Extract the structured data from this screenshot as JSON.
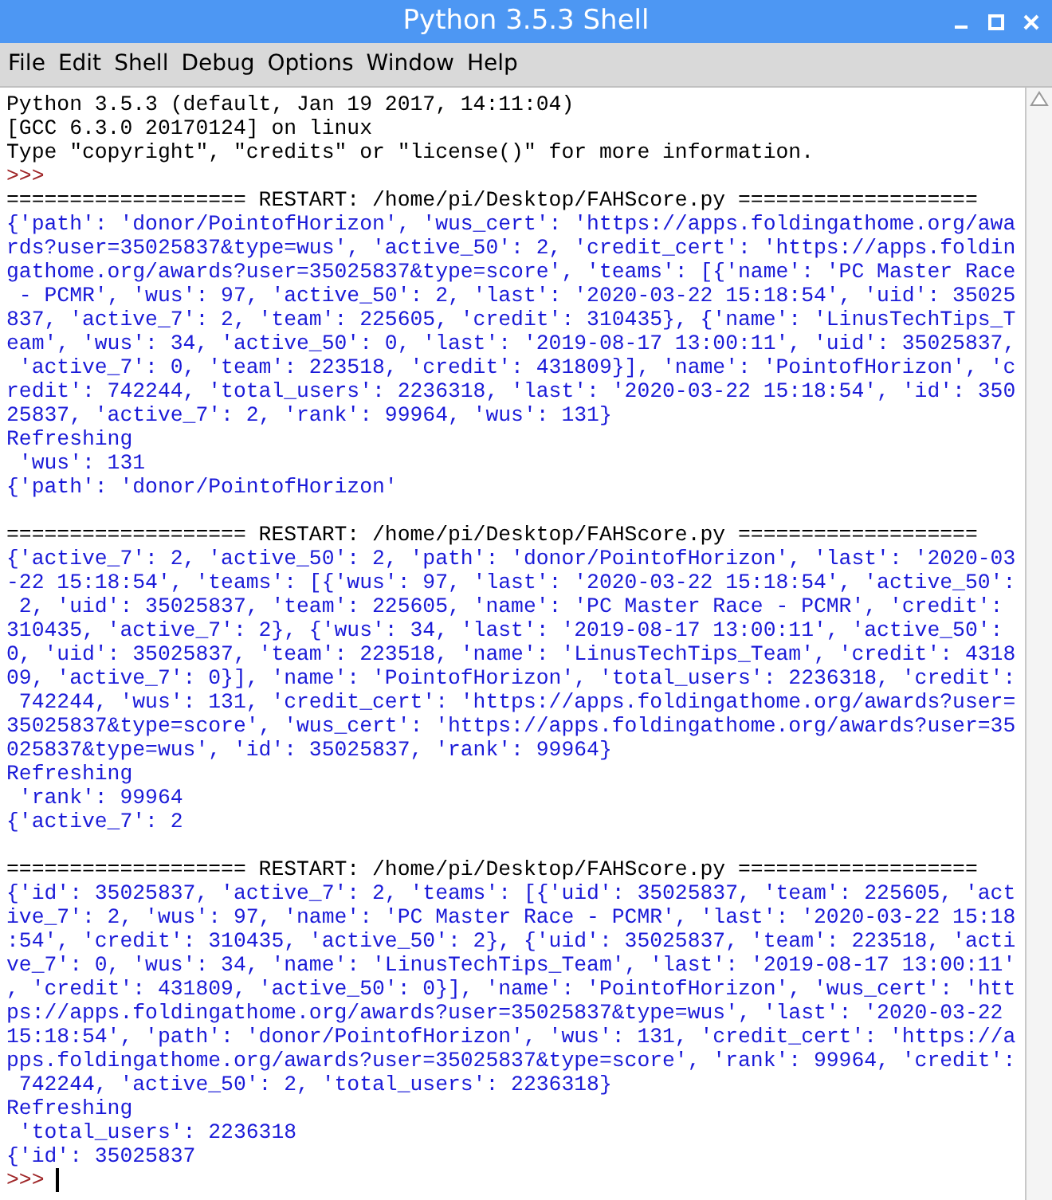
{
  "window": {
    "title": "Python 3.5.3 Shell"
  },
  "menu": [
    "File",
    "Edit",
    "Shell",
    "Debug",
    "Options",
    "Window",
    "Help"
  ],
  "lines": [
    {
      "kind": "banner",
      "text": "Python 3.5.3 (default, Jan 19 2017, 14:11:04)"
    },
    {
      "kind": "banner",
      "text": "[GCC 6.3.0 20170124] on linux"
    },
    {
      "kind": "banner",
      "text": "Type \"copyright\", \"credits\" or \"license()\" for more information."
    },
    {
      "kind": "prompt",
      "text": ">>>",
      "cursor": false
    },
    {
      "kind": "restart",
      "text": "=================== RESTART: /home/pi/Desktop/FAHScore.py ==================="
    },
    {
      "kind": "output",
      "text": "{'path': 'donor/PointofHorizon', 'wus_cert': 'https://apps.foldingathome.org/awa"
    },
    {
      "kind": "output",
      "text": "rds?user=35025837&type=wus', 'active_50': 2, 'credit_cert': 'https://apps.foldin"
    },
    {
      "kind": "output",
      "text": "gathome.org/awards?user=35025837&type=score', 'teams': [{'name': 'PC Master Race"
    },
    {
      "kind": "output",
      "text": " - PCMR', 'wus': 97, 'active_50': 2, 'last': '2020-03-22 15:18:54', 'uid': 35025"
    },
    {
      "kind": "output",
      "text": "837, 'active_7': 2, 'team': 225605, 'credit': 310435}, {'name': 'LinusTechTips_T"
    },
    {
      "kind": "output",
      "text": "eam', 'wus': 34, 'active_50': 0, 'last': '2019-08-17 13:00:11', 'uid': 35025837,"
    },
    {
      "kind": "output",
      "text": " 'active_7': 0, 'team': 223518, 'credit': 431809}], 'name': 'PointofHorizon', 'c"
    },
    {
      "kind": "output",
      "text": "redit': 742244, 'total_users': 2236318, 'last': '2020-03-22 15:18:54', 'id': 350"
    },
    {
      "kind": "output",
      "text": "25837, 'active_7': 2, 'rank': 99964, 'wus': 131}"
    },
    {
      "kind": "output",
      "text": "Refreshing"
    },
    {
      "kind": "output",
      "text": " 'wus': 131"
    },
    {
      "kind": "output",
      "text": "{'path': 'donor/PointofHorizon'"
    },
    {
      "kind": "blank"
    },
    {
      "kind": "restart",
      "text": "=================== RESTART: /home/pi/Desktop/FAHScore.py ==================="
    },
    {
      "kind": "output",
      "text": "{'active_7': 2, 'active_50': 2, 'path': 'donor/PointofHorizon', 'last': '2020-03"
    },
    {
      "kind": "output",
      "text": "-22 15:18:54', 'teams': [{'wus': 97, 'last': '2020-03-22 15:18:54', 'active_50':"
    },
    {
      "kind": "output",
      "text": " 2, 'uid': 35025837, 'team': 225605, 'name': 'PC Master Race - PCMR', 'credit':"
    },
    {
      "kind": "output",
      "text": "310435, 'active_7': 2}, {'wus': 34, 'last': '2019-08-17 13:00:11', 'active_50':"
    },
    {
      "kind": "output",
      "text": "0, 'uid': 35025837, 'team': 223518, 'name': 'LinusTechTips_Team', 'credit': 4318"
    },
    {
      "kind": "output",
      "text": "09, 'active_7': 0}], 'name': 'PointofHorizon', 'total_users': 2236318, 'credit':"
    },
    {
      "kind": "output",
      "text": " 742244, 'wus': 131, 'credit_cert': 'https://apps.foldingathome.org/awards?user="
    },
    {
      "kind": "output",
      "text": "35025837&type=score', 'wus_cert': 'https://apps.foldingathome.org/awards?user=35"
    },
    {
      "kind": "output",
      "text": "025837&type=wus', 'id': 35025837, 'rank': 99964}"
    },
    {
      "kind": "output",
      "text": "Refreshing"
    },
    {
      "kind": "output",
      "text": " 'rank': 99964"
    },
    {
      "kind": "output",
      "text": "{'active_7': 2"
    },
    {
      "kind": "blank"
    },
    {
      "kind": "restart",
      "text": "=================== RESTART: /home/pi/Desktop/FAHScore.py ==================="
    },
    {
      "kind": "output",
      "text": "{'id': 35025837, 'active_7': 2, 'teams': [{'uid': 35025837, 'team': 225605, 'act"
    },
    {
      "kind": "output",
      "text": "ive_7': 2, 'wus': 97, 'name': 'PC Master Race - PCMR', 'last': '2020-03-22 15:18"
    },
    {
      "kind": "output",
      "text": ":54', 'credit': 310435, 'active_50': 2}, {'uid': 35025837, 'team': 223518, 'acti"
    },
    {
      "kind": "output",
      "text": "ve_7': 0, 'wus': 34, 'name': 'LinusTechTips_Team', 'last': '2019-08-17 13:00:11'"
    },
    {
      "kind": "output",
      "text": ", 'credit': 431809, 'active_50': 0}], 'name': 'PointofHorizon', 'wus_cert': 'htt"
    },
    {
      "kind": "output",
      "text": "ps://apps.foldingathome.org/awards?user=35025837&type=wus', 'last': '2020-03-22"
    },
    {
      "kind": "output",
      "text": "15:18:54', 'path': 'donor/PointofHorizon', 'wus': 131, 'credit_cert': 'https://a"
    },
    {
      "kind": "output",
      "text": "pps.foldingathome.org/awards?user=35025837&type=score', 'rank': 99964, 'credit':"
    },
    {
      "kind": "output",
      "text": " 742244, 'active_50': 2, 'total_users': 2236318}"
    },
    {
      "kind": "output",
      "text": "Refreshing"
    },
    {
      "kind": "output",
      "text": " 'total_users': 2236318"
    },
    {
      "kind": "output",
      "text": "{'id': 35025837"
    },
    {
      "kind": "prompt",
      "text": ">>>",
      "cursor": true
    }
  ]
}
